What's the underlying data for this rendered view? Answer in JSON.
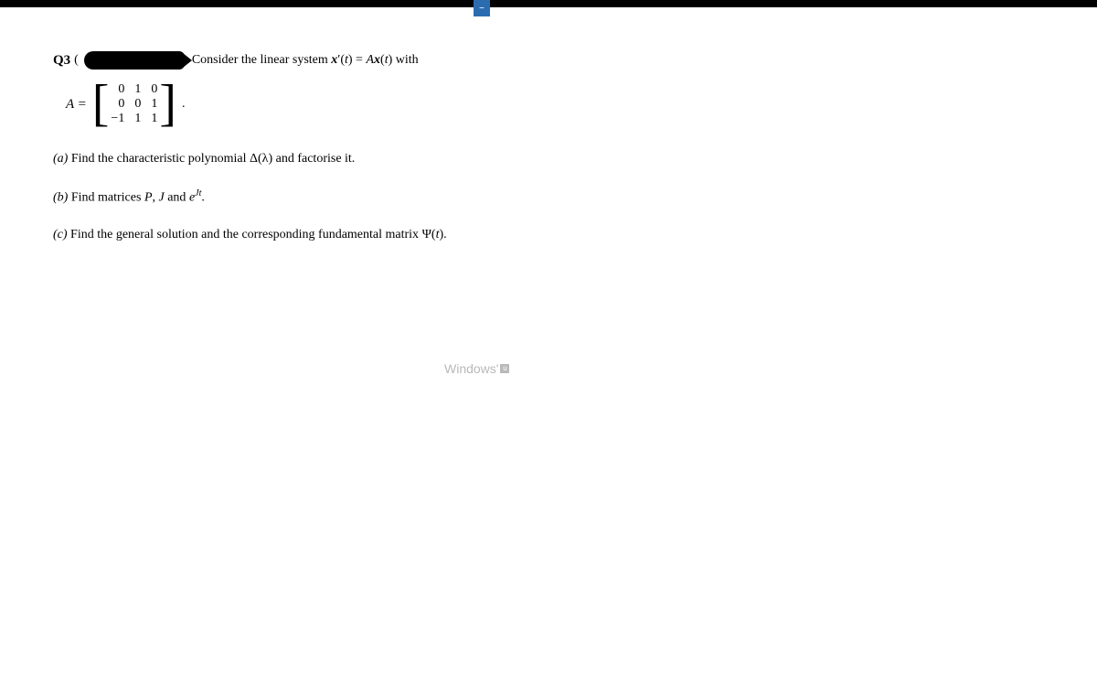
{
  "header": {
    "question_label": "Q3",
    "paren_open": "(",
    "intro_prefix": " Consider the linear system ",
    "intro_vec": "x",
    "intro_prime": "′(",
    "intro_t1": "t",
    "intro_eq": ") = ",
    "intro_A": "A",
    "intro_vec2": "x",
    "intro_paren2": "(",
    "intro_t2": "t",
    "intro_suffix": ") with"
  },
  "matrix": {
    "lhs": "A =",
    "r0c0": "0",
    "r0c1": "1",
    "r0c2": "0",
    "r1c0": "0",
    "r1c1": "0",
    "r1c2": "1",
    "r2c0": "−1",
    "r2c1": "1",
    "r2c2": "1",
    "period": "."
  },
  "parts": {
    "a_label": "(a)",
    "a_text_pre": " Find the characteristic polynomial ",
    "a_delta": "Δ(λ)",
    "a_text_post": " and factorise it.",
    "b_label": "(b)",
    "b_text_pre": " Find matrices ",
    "b_P": "P",
    "b_comma": ", ",
    "b_J": "J",
    "b_and": " and ",
    "b_e": "e",
    "b_exp": "Jt",
    "b_period": ".",
    "c_label": "(c)",
    "c_text_pre": " Find the general solution and the corresponding fundamental matrix ",
    "c_psi": "Ψ(",
    "c_t": "t",
    "c_close": ")."
  },
  "watermark": {
    "text": "Windows'",
    "box": "u"
  },
  "tab": {
    "glyph": "−"
  }
}
